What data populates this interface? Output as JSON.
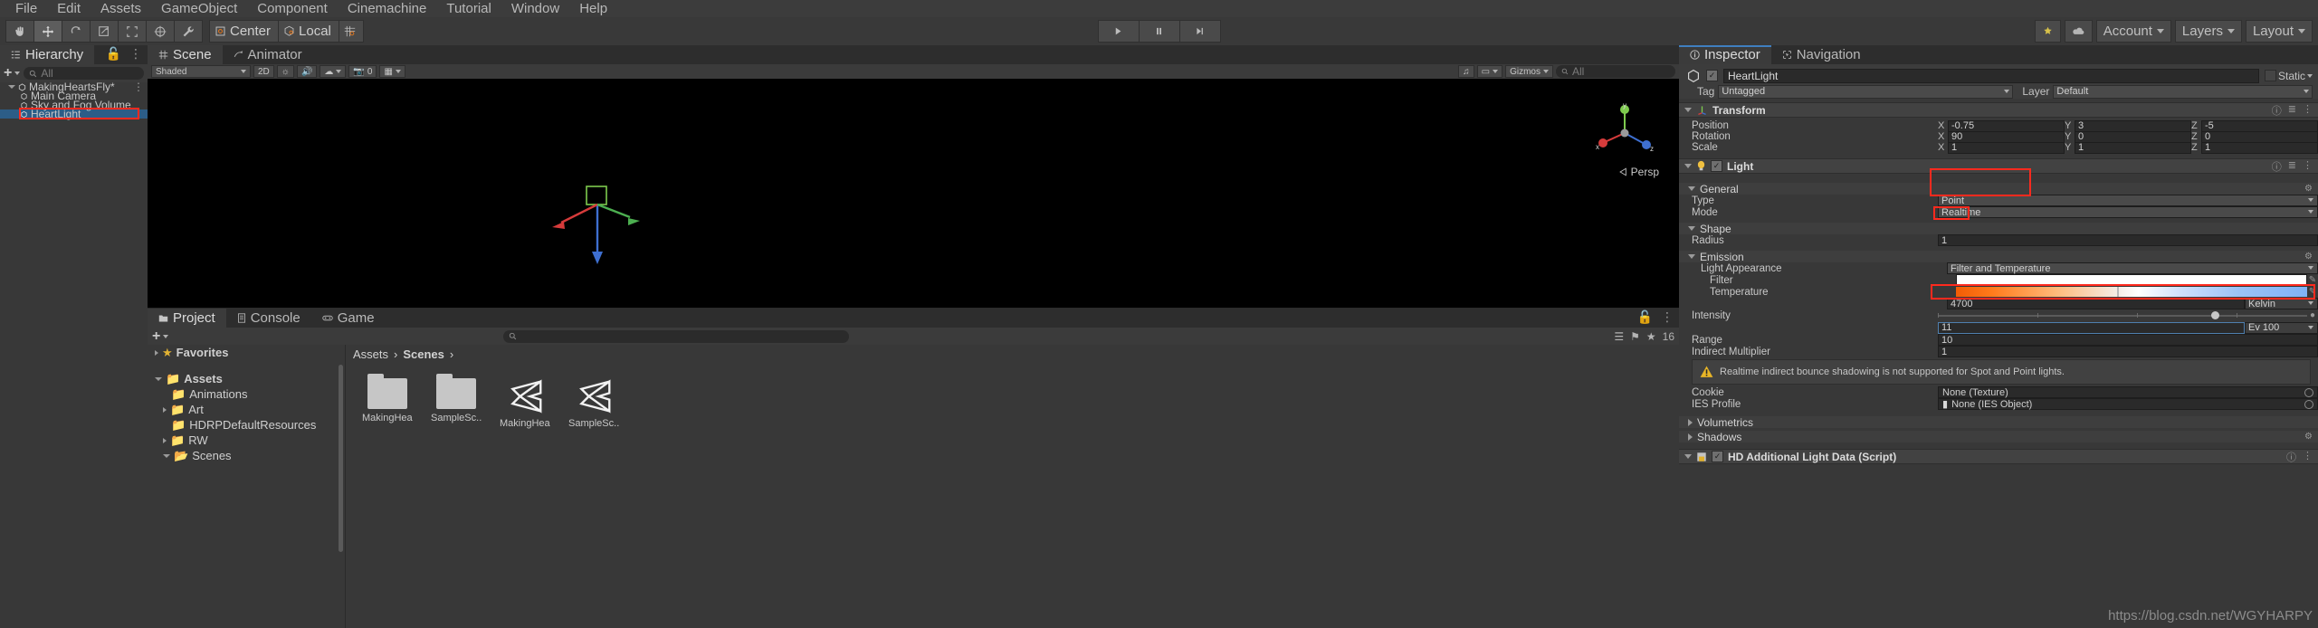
{
  "menubar": {
    "items": [
      "File",
      "Edit",
      "Assets",
      "GameObject",
      "Component",
      "Cinemachine",
      "Tutorial",
      "Window",
      "Help"
    ]
  },
  "toolbar": {
    "tools": [
      "hand-tool",
      "move-tool",
      "rotate-tool",
      "scale-tool",
      "rect-tool",
      "transform-tool",
      "custom-tool"
    ],
    "pivot_mode": "Center",
    "pivot_space": "Local",
    "play": "play-button",
    "pause": "pause-button",
    "step": "step-button",
    "collab": "Collab",
    "cloud": "cloud-button",
    "account": "Account",
    "layers": "Layers",
    "layout": "Layout"
  },
  "hierarchy": {
    "tab": "Hierarchy",
    "add_label": "+",
    "search_placeholder": "All",
    "items": [
      {
        "label": "MakingHeartsFly*",
        "depth": 0,
        "expanded": true,
        "icon": "scene-icon",
        "selected": false
      },
      {
        "label": "Main Camera",
        "depth": 1,
        "expanded": false,
        "icon": "gameobject-icon",
        "selected": false
      },
      {
        "label": "Sky and Fog Volume",
        "depth": 1,
        "expanded": false,
        "icon": "gameobject-icon",
        "selected": false
      },
      {
        "label": "HeartLight",
        "depth": 1,
        "expanded": false,
        "icon": "gameobject-icon",
        "selected": true
      }
    ]
  },
  "scene": {
    "tabs": [
      {
        "label": "Scene",
        "active": true,
        "icon": "scene-tab-icon"
      },
      {
        "label": "Animator",
        "active": false,
        "icon": "animator-tab-icon"
      }
    ],
    "shading": "Shaded",
    "mode_2d": "2D",
    "light_toggle": "light-icon",
    "audio_toggle": "audio-icon",
    "fx_toggle": "fx-icon",
    "camera_count": "0",
    "gizmos": "Gizmos",
    "search_placeholder": "All",
    "view_label": "Persp",
    "axis_x": "x",
    "axis_y": "y",
    "axis_z": "z"
  },
  "project": {
    "tabs": [
      {
        "label": "Project",
        "active": true,
        "icon": "project-tab-icon"
      },
      {
        "label": "Console",
        "active": false,
        "icon": "console-tab-icon"
      },
      {
        "label": "Game",
        "active": false,
        "icon": "game-tab-icon"
      }
    ],
    "add_label": "+",
    "search_placeholder": "",
    "item_count": "16",
    "tree": [
      {
        "label": "Favorites",
        "depth": 0,
        "arrow": "closed",
        "icon": "star-icon"
      },
      {
        "label": "Assets",
        "depth": 0,
        "arrow": "open",
        "icon": "folder-icon"
      },
      {
        "label": "Animations",
        "depth": 1,
        "arrow": "none",
        "icon": "folder-icon"
      },
      {
        "label": "Art",
        "depth": 1,
        "arrow": "closed",
        "icon": "folder-icon"
      },
      {
        "label": "HDRPDefaultResources",
        "depth": 1,
        "arrow": "none",
        "icon": "folder-icon"
      },
      {
        "label": "RW",
        "depth": 1,
        "arrow": "closed",
        "icon": "folder-icon"
      },
      {
        "label": "Scenes",
        "depth": 1,
        "arrow": "open",
        "icon": "folder-icon"
      }
    ],
    "breadcrumbs": [
      "Assets",
      "Scenes"
    ],
    "grid": [
      {
        "label": "MakingHea...",
        "type": "folder"
      },
      {
        "label": "SampleSc...",
        "type": "folder"
      },
      {
        "label": "MakingHea...",
        "type": "unity-scene"
      },
      {
        "label": "SampleSc...",
        "type": "unity-scene"
      }
    ]
  },
  "inspector": {
    "tabs": [
      {
        "label": "Inspector",
        "active": true,
        "icon": "info-icon"
      },
      {
        "label": "Navigation",
        "active": false,
        "icon": "navigation-icon"
      }
    ],
    "object": {
      "name": "HeartLight",
      "enabled": true,
      "tag_label": "Tag",
      "tag_value": "Untagged",
      "layer_label": "Layer",
      "layer_value": "Default",
      "static_label": "Static"
    },
    "transform": {
      "title": "Transform",
      "rows": [
        {
          "label": "Position",
          "x": "-0.75",
          "y": "3",
          "z": "-5"
        },
        {
          "label": "Rotation",
          "x": "90",
          "y": "0",
          "z": "0"
        },
        {
          "label": "Scale",
          "x": "1",
          "y": "1",
          "z": "1"
        }
      ],
      "axis_labels": [
        "X",
        "Y",
        "Z"
      ]
    },
    "light": {
      "title": "Light",
      "enabled": true,
      "general": {
        "title": "General",
        "type_label": "Type",
        "type_value": "Point",
        "mode_label": "Mode",
        "mode_value": "Realtime"
      },
      "shape": {
        "title": "Shape",
        "radius_label": "Radius",
        "radius_value": "1"
      },
      "emission": {
        "title": "Emission",
        "appearance_label": "Light Appearance",
        "appearance_value": "Filter and Temperature",
        "filter_label": "Filter",
        "temperature_label": "Temperature",
        "temperature_value": "4700",
        "temperature_unit": "Kelvin",
        "intensity_label": "Intensity",
        "intensity_value": "11",
        "intensity_unit": "Ev 100",
        "range_label": "Range",
        "range_value": "10",
        "indirect_label": "Indirect Multiplier",
        "indirect_value": "1",
        "warning": "Realtime indirect bounce shadowing is not supported for Spot and Point lights.",
        "cookie_label": "Cookie",
        "cookie_value": "None (Texture)",
        "ies_label": "IES Profile",
        "ies_value": "None (IES Object)"
      },
      "volumetrics_title": "Volumetrics",
      "shadows_title": "Shadows"
    },
    "hd_script": {
      "title": "HD Additional Light Data (Script)",
      "enabled": true
    }
  },
  "watermark": "https://blog.csdn.net/WGYHARPY",
  "colors": {
    "highlight": "#ff2a1e",
    "selection": "#2c5d87",
    "accent_tab": "#3f7fbf"
  }
}
